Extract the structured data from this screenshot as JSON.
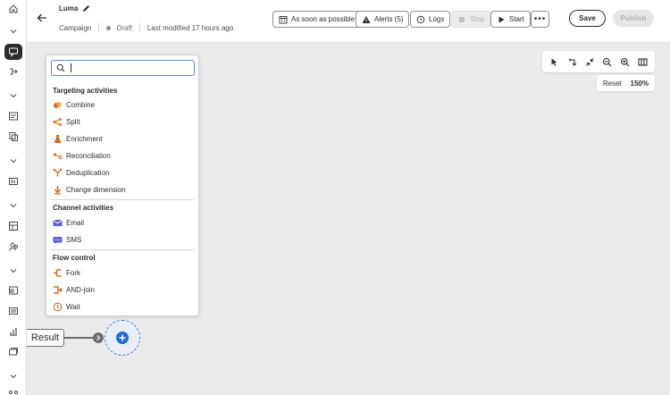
{
  "header": {
    "title": "Luma",
    "breadcrumb": "Campaign",
    "status": "Draft",
    "last_modified": "Last modified 17 hours ago",
    "schedule_label": "As soon as possible",
    "alerts_label": "Alerts (5)",
    "logs_label": "Logs",
    "stop_label": "Stop",
    "start_label": "Start",
    "save_label": "Save",
    "publish_label": "Publish"
  },
  "canvas": {
    "reset_label": "Reset",
    "zoom": "150%",
    "result_label": "Result"
  },
  "activities": {
    "search_placeholder": "",
    "targeting_title": "Targeting activities",
    "targeting": [
      "Combine",
      "Split",
      "Enrichment",
      "Reconciliation",
      "Deduplication",
      "Change dimension"
    ],
    "channel_title": "Channel activities",
    "channel": [
      "Email",
      "SMS"
    ],
    "flow_title": "Flow control",
    "flow": [
      "Fork",
      "AND-join",
      "Wait"
    ]
  },
  "colors": {
    "accent": "#1f6ad6",
    "activity_orange": "#d66b1c",
    "channel_blue": "#5a5fd6"
  },
  "icons": {
    "rail": [
      "home-icon",
      "chevron-down-icon",
      "campaign-icon",
      "journey-icon",
      "chevron-down-icon",
      "form-icon",
      "content-icon",
      "chevron-down-icon",
      "template-icon",
      "chevron-down-icon",
      "dashboard-icon",
      "audience-icon",
      "chevron-down-icon",
      "catalog-icon",
      "table-icon",
      "chart-icon",
      "channel-icon",
      "chevron-down-icon",
      "more-icon"
    ]
  }
}
